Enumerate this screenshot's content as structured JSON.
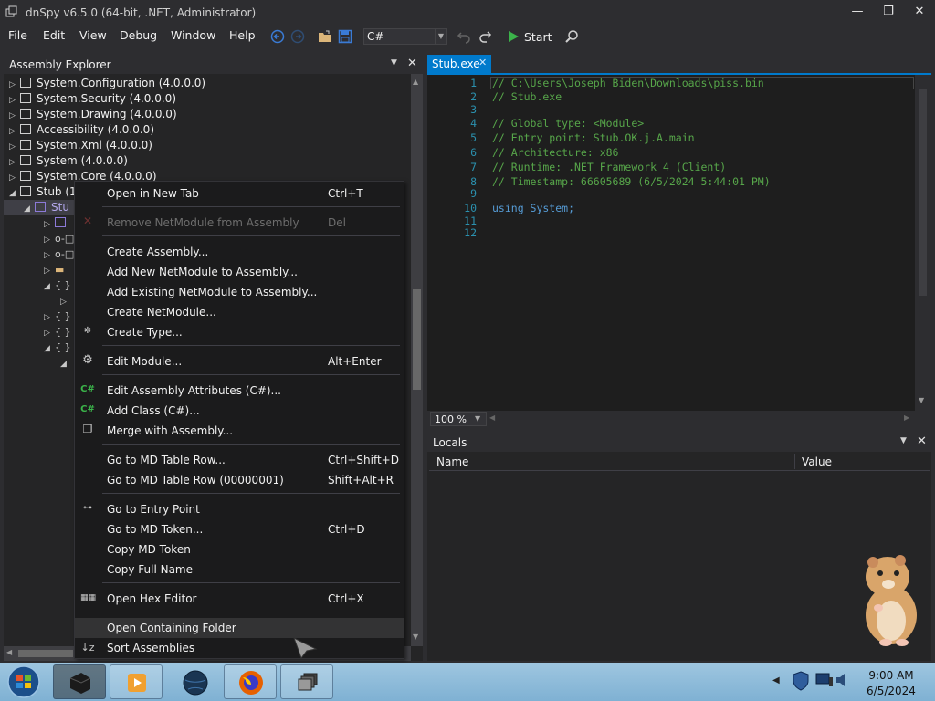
{
  "window": {
    "title": "dnSpy v6.5.0 (64-bit, .NET, Administrator)",
    "minimize_glyph": "—",
    "maximize_glyph": "❐",
    "close_glyph": "✕"
  },
  "menubar": {
    "items": [
      "File",
      "Edit",
      "View",
      "Debug",
      "Window",
      "Help"
    ]
  },
  "toolbar": {
    "language": "C#",
    "start_label": "Start",
    "icons": [
      "back-icon",
      "forward-icon",
      "open-folder-icon",
      "save-icon",
      "undo-icon",
      "redo-icon",
      "play-icon",
      "search-icon"
    ]
  },
  "assembly_explorer": {
    "title": "Assembly Explorer",
    "items": [
      {
        "label": "System.Configuration (4.0.0.0)"
      },
      {
        "label": "System.Security (4.0.0.0)"
      },
      {
        "label": "System.Drawing (4.0.0.0)"
      },
      {
        "label": "Accessibility (4.0.0.0)"
      },
      {
        "label": "System.Xml (4.0.0.0)"
      },
      {
        "label": "System (4.0.0.0)"
      },
      {
        "label": "System.Core (4.0.0.0)"
      },
      {
        "label": "Stub (1"
      },
      {
        "label": "Stu"
      }
    ]
  },
  "context_menu": {
    "items": [
      {
        "label": "Open in New Tab",
        "shortcut": "Ctrl+T",
        "icon": "",
        "disabled": false
      },
      {
        "label": "Remove NetModule from Assembly",
        "shortcut": "Del",
        "icon": "remove-icon",
        "disabled": true
      },
      {
        "label": "Create Assembly...",
        "shortcut": "",
        "icon": "",
        "disabled": false
      },
      {
        "label": "Add New NetModule to Assembly...",
        "shortcut": "",
        "icon": "",
        "disabled": false
      },
      {
        "label": "Add Existing NetModule to Assembly...",
        "shortcut": "",
        "icon": "",
        "disabled": false
      },
      {
        "label": "Create NetModule...",
        "shortcut": "",
        "icon": "",
        "disabled": false
      },
      {
        "label": "Create Type...",
        "shortcut": "",
        "icon": "create-type-icon",
        "disabled": false
      },
      {
        "label": "Edit Module...",
        "shortcut": "Alt+Enter",
        "icon": "gear-icon",
        "disabled": false
      },
      {
        "label": "Edit Assembly Attributes (C#)...",
        "shortcut": "",
        "icon": "csharp-icon",
        "disabled": false
      },
      {
        "label": "Add Class (C#)...",
        "shortcut": "",
        "icon": "csharp-icon",
        "disabled": false
      },
      {
        "label": "Merge with Assembly...",
        "shortcut": "",
        "icon": "assembly-icon",
        "disabled": false
      },
      {
        "label": "Go to MD Table Row...",
        "shortcut": "Ctrl+Shift+D",
        "icon": "",
        "disabled": false
      },
      {
        "label": "Go to MD Table Row (00000001)",
        "shortcut": "Shift+Alt+R",
        "icon": "",
        "disabled": false
      },
      {
        "label": "Go to Entry Point",
        "shortcut": "",
        "icon": "entry-point-icon",
        "disabled": false
      },
      {
        "label": "Go to MD Token...",
        "shortcut": "Ctrl+D",
        "icon": "",
        "disabled": false
      },
      {
        "label": "Copy MD Token",
        "shortcut": "",
        "icon": "",
        "disabled": false
      },
      {
        "label": "Copy Full Name",
        "shortcut": "",
        "icon": "",
        "disabled": false
      },
      {
        "label": "Open Hex Editor",
        "shortcut": "Ctrl+X",
        "icon": "hex-editor-icon",
        "disabled": false
      },
      {
        "label": "Open Containing Folder",
        "shortcut": "",
        "icon": "",
        "disabled": false
      },
      {
        "label": "Sort Assemblies",
        "shortcut": "",
        "icon": "sort-icon",
        "disabled": false
      }
    ]
  },
  "editor": {
    "tab_label": "Stub.exe",
    "tab_close": "✕",
    "lines": [
      {
        "n": "1",
        "text": "// C:\\Users\\Joseph Biden\\Downloads\\piss.bin",
        "kind": "comment"
      },
      {
        "n": "2",
        "text": "// Stub.exe",
        "kind": "comment"
      },
      {
        "n": "3",
        "text": "",
        "kind": "comment"
      },
      {
        "n": "4",
        "text": "// Global type: <Module>",
        "kind": "comment"
      },
      {
        "n": "5",
        "text": "// Entry point: Stub.OK.j.A.main",
        "kind": "comment"
      },
      {
        "n": "6",
        "text": "// Architecture: x86",
        "kind": "comment"
      },
      {
        "n": "7",
        "text": "// Runtime: .NET Framework 4 (Client)",
        "kind": "comment"
      },
      {
        "n": "8",
        "text": "// Timestamp: 66605689 (6/5/2024 5:44:01 PM)",
        "kind": "comment"
      },
      {
        "n": "9",
        "text": "",
        "kind": "comment"
      },
      {
        "n": "10",
        "text": "using System;",
        "kind": "code"
      },
      {
        "n": "11",
        "text": "",
        "kind": "code"
      },
      {
        "n": "12",
        "text": "",
        "kind": "code"
      }
    ],
    "zoom": "100 %"
  },
  "locals": {
    "title": "Locals",
    "columns": [
      "Name",
      "Value"
    ]
  },
  "taskbar": {
    "time": "9:00 AM",
    "date": "6/5/2024"
  },
  "colors": {
    "accent": "#007acc",
    "background": "#2d2d30",
    "panel": "#252526",
    "comment": "#57a64a",
    "keyword": "#569cd6",
    "line_number": "#2b91af"
  }
}
